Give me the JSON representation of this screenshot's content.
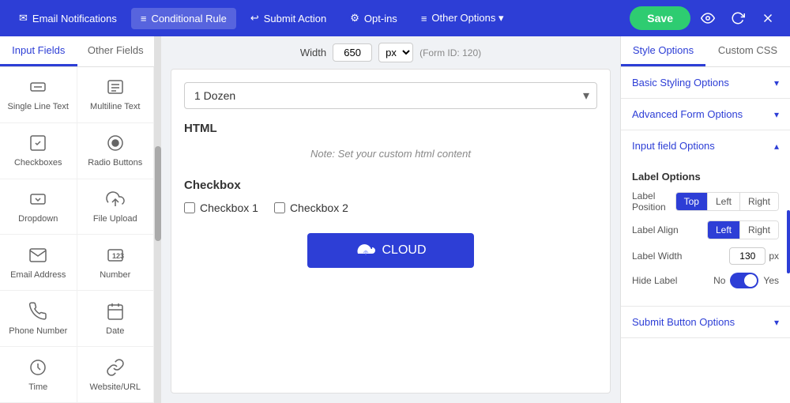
{
  "nav": {
    "items": [
      {
        "id": "email-notifications",
        "icon": "✉",
        "label": "Email Notifications"
      },
      {
        "id": "conditional-rule",
        "icon": "≡",
        "label": "Conditional Rule"
      },
      {
        "id": "submit-action",
        "icon": "↩",
        "label": "Submit Action"
      },
      {
        "id": "opt-ins",
        "icon": "⚙",
        "label": "Opt-ins"
      },
      {
        "id": "other-options",
        "icon": "≡",
        "label": "Other Options ▾"
      }
    ],
    "save_label": "Save"
  },
  "left_panel": {
    "tab_input": "Input Fields",
    "tab_other": "Other Fields",
    "fields": [
      {
        "id": "single-line-text",
        "label": "Single Line Text",
        "icon": "single-line"
      },
      {
        "id": "multiline-text",
        "label": "Multiline Text",
        "icon": "multiline"
      },
      {
        "id": "checkboxes",
        "label": "Checkboxes",
        "icon": "checkbox"
      },
      {
        "id": "radio-buttons",
        "label": "Radio Buttons",
        "icon": "radio"
      },
      {
        "id": "dropdown",
        "label": "Dropdown",
        "icon": "dropdown"
      },
      {
        "id": "file-upload",
        "label": "File Upload",
        "icon": "upload"
      },
      {
        "id": "email-address",
        "label": "Email Address",
        "icon": "email"
      },
      {
        "id": "number",
        "label": "Number",
        "icon": "number"
      },
      {
        "id": "phone-number",
        "label": "Phone Number",
        "icon": "phone"
      },
      {
        "id": "date",
        "label": "Date",
        "icon": "date"
      },
      {
        "id": "time",
        "label": "Time",
        "icon": "time"
      },
      {
        "id": "website-url",
        "label": "Website/URL",
        "icon": "link"
      }
    ]
  },
  "center": {
    "width_label": "Width",
    "width_value": "650",
    "width_unit": "px",
    "form_id": "(Form ID: 120)",
    "dropdown_value": "1 Dozen",
    "html_label": "HTML",
    "html_note": "Note: Set your custom html content",
    "checkbox_label": "Checkbox",
    "checkbox1": "Checkbox 1",
    "checkbox2": "Checkbox 2",
    "submit_label": "CLOUD"
  },
  "right_panel": {
    "tab_style": "Style Options",
    "tab_css": "Custom CSS",
    "accordions": [
      {
        "id": "basic-styling",
        "label": "Basic Styling Options",
        "expanded": false
      },
      {
        "id": "advanced-form",
        "label": "Advanced Form Options",
        "expanded": false
      },
      {
        "id": "input-field",
        "label": "Input field Options",
        "expanded": true
      }
    ],
    "input_field_options": {
      "label_options_title": "Label Options",
      "label_position_label": "Label Position",
      "label_position_options": [
        "Top",
        "Left",
        "Right"
      ],
      "label_position_active": "Top",
      "label_align_label": "Label Align",
      "label_align_options": [
        "Left",
        "Right"
      ],
      "label_align_active": "Left",
      "label_width_label": "Label Width",
      "label_width_value": "130",
      "label_width_unit": "px",
      "hide_label_label": "Hide Label",
      "hide_label_no": "No",
      "hide_label_yes": "Yes"
    },
    "submit_accordion_label": "Submit Button Options"
  },
  "colors": {
    "accent": "#2d3ed6",
    "active_btn": "#2d3ed6",
    "save_green": "#2ecc71"
  }
}
